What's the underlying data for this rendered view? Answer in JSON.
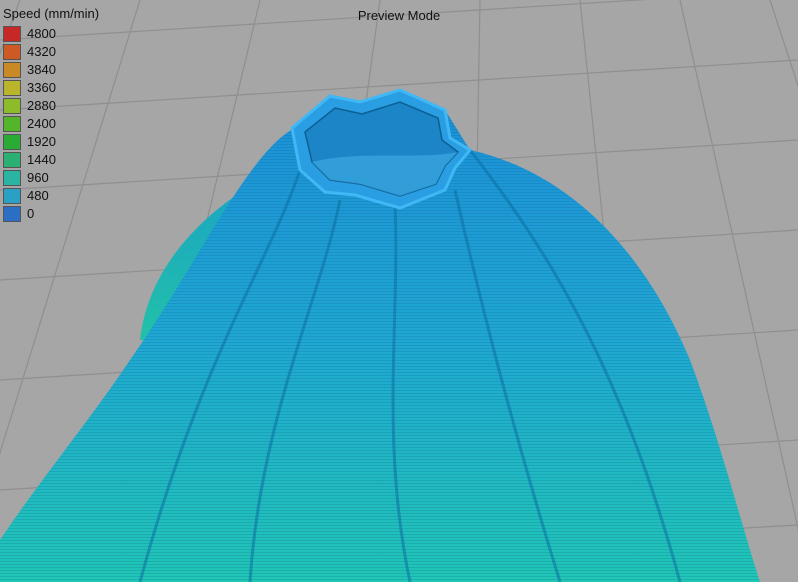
{
  "header": {
    "mode_title": "Preview Mode"
  },
  "legend": {
    "title": "Speed (mm/min)",
    "items": [
      {
        "label": "4800",
        "color": "#c62828"
      },
      {
        "label": "4320",
        "color": "#cd5a22"
      },
      {
        "label": "3840",
        "color": "#c98a26"
      },
      {
        "label": "3360",
        "color": "#b8b52a"
      },
      {
        "label": "2880",
        "color": "#8cbc2a"
      },
      {
        "label": "2400",
        "color": "#55b52a"
      },
      {
        "label": "1920",
        "color": "#2aab35"
      },
      {
        "label": "1440",
        "color": "#2ab071"
      },
      {
        "label": "960",
        "color": "#2ab4a4"
      },
      {
        "label": "480",
        "color": "#2aa0c4"
      },
      {
        "label": "0",
        "color": "#2a6fc4"
      }
    ]
  },
  "scene": {
    "colors": {
      "background": "#a6a6a6",
      "grid": "#8d8d8d",
      "model_top": "#1b8fd6",
      "model_bottom": "#1fc2b8",
      "rim": "#3ab0f0"
    }
  }
}
